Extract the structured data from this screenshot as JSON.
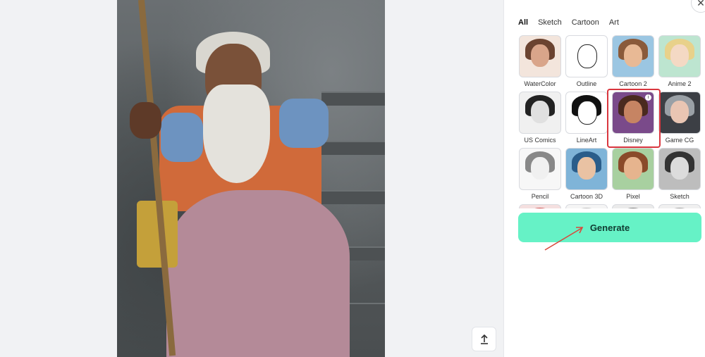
{
  "tabs": [
    {
      "label": "All",
      "active": true
    },
    {
      "label": "Sketch",
      "active": false
    },
    {
      "label": "Cartoon",
      "active": false
    },
    {
      "label": "Art",
      "active": false
    }
  ],
  "styles": [
    {
      "label": "WaterColor",
      "hair": "#6b4330",
      "face": "#d9a58a",
      "bg": "#f3e5dc"
    },
    {
      "label": "Outline",
      "hair": "#ffffff",
      "face": "#ffffff",
      "bg": "#ffffff"
    },
    {
      "label": "Cartoon 2",
      "hair": "#8a5a3a",
      "face": "#e8b995",
      "bg": "#9bc6e2"
    },
    {
      "label": "Anime 2",
      "hair": "#e8d18a",
      "face": "#f4d9c4",
      "bg": "#bde5d0"
    },
    {
      "label": "US Comics",
      "hair": "#222222",
      "face": "#e0e0e0",
      "bg": "#f0f0f0"
    },
    {
      "label": "LineArt",
      "hair": "#111111",
      "face": "#ffffff",
      "bg": "#ffffff"
    },
    {
      "label": "Disney",
      "hair": "#4a2a1f",
      "face": "#c68463",
      "bg": "#7a4a8a"
    },
    {
      "label": "Game CG",
      "hair": "#9aa0a6",
      "face": "#e9c5b3",
      "bg": "#3c3f45"
    },
    {
      "label": "Pencil",
      "hair": "#888888",
      "face": "#f0f0f0",
      "bg": "#f7f7f7"
    },
    {
      "label": "Cartoon 3D",
      "hair": "#2a5d8a",
      "face": "#e9c2a3",
      "bg": "#7fb4d8"
    },
    {
      "label": "Pixel",
      "hair": "#8a4a2a",
      "face": "#e6b48e",
      "bg": "#a8d0a0"
    },
    {
      "label": "Sketch",
      "hair": "#333333",
      "face": "#dcdcdc",
      "bg": "#bdbdbd"
    },
    {
      "label": "",
      "hair": "#c94848",
      "face": "#f0d0c0",
      "bg": "#f5e0e0"
    },
    {
      "label": "",
      "hair": "#bbbbbb",
      "face": "#f0f0f0",
      "bg": "#f5f5f5"
    },
    {
      "label": "",
      "hair": "#777777",
      "face": "#e0d0c0",
      "bg": "#ebebeb"
    },
    {
      "label": "",
      "hair": "#999999",
      "face": "#e8e8e8",
      "bg": "#f0f0f0"
    }
  ],
  "generate_label": "Generate",
  "close_symbol": "✕",
  "upload_icon": "upload-icon",
  "info_symbol": "i",
  "accent": "#66f2c6",
  "selection_color": "#d9363e"
}
